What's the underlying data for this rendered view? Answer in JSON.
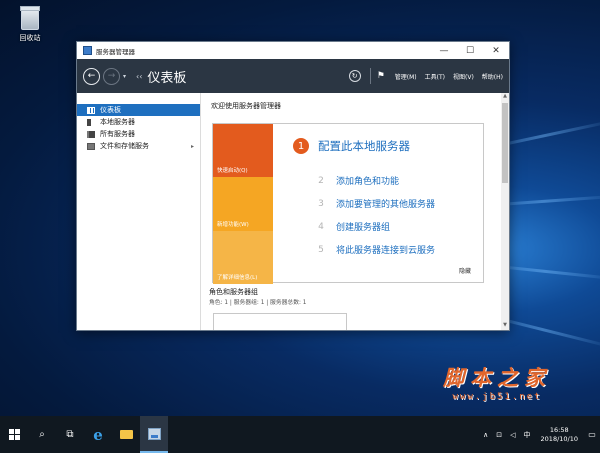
{
  "desktop": {
    "recycle_bin_label": "回收站"
  },
  "window": {
    "title": "服务器管理器",
    "controls": {
      "minimize": "—",
      "maximize": "☐",
      "close": "✕"
    }
  },
  "toolbar": {
    "back": "←",
    "forward": "→",
    "dropdown": "▾",
    "breadcrumb_prefix": "‹‹",
    "page_title": "仪表板",
    "refresh": "↻",
    "flag": "⚑",
    "menus": [
      "管理(M)",
      "工具(T)",
      "视图(V)",
      "帮助(H)"
    ]
  },
  "sidebar": {
    "items": [
      {
        "label": "仪表板",
        "active": true
      },
      {
        "label": "本地服务器",
        "active": false
      },
      {
        "label": "所有服务器",
        "active": false
      },
      {
        "label": "文件和存储服务",
        "active": false
      }
    ],
    "chevron": "▸"
  },
  "main": {
    "welcome_heading": "欢迎使用服务器管理器",
    "tiles": [
      "快速启动(Q)",
      "新增功能(W)",
      "了解详细信息(L)"
    ],
    "steps": [
      {
        "num": "1",
        "label": "配置此本地服务器"
      },
      {
        "num": "2",
        "label": "添加角色和功能"
      },
      {
        "num": "3",
        "label": "添加要管理的其他服务器"
      },
      {
        "num": "4",
        "label": "创建服务器组"
      },
      {
        "num": "5",
        "label": "将此服务器连接到云服务"
      }
    ],
    "hide_link": "隐藏",
    "roles_heading": "角色和服务器组",
    "roles_summary": "角色: 1 | 服务器组: 1 | 服务器总数: 1",
    "scroll_up": "▲",
    "scroll_down": "▼"
  },
  "watermark": {
    "logo": "脚本之家",
    "url": "www.jb51.net"
  },
  "taskbar": {
    "search": "⌕",
    "task_view": "⧉",
    "ie": "e",
    "tray": {
      "up_arrow": "∧",
      "network": "⊡",
      "volume": "◁",
      "ime": "中"
    },
    "clock_time": "16:58",
    "clock_date": "2018/10/10",
    "notifications": "▭"
  },
  "colors": {
    "accent": "#1e6fbf",
    "orange": "#e35b1e",
    "toolbar": "#2b3643"
  }
}
